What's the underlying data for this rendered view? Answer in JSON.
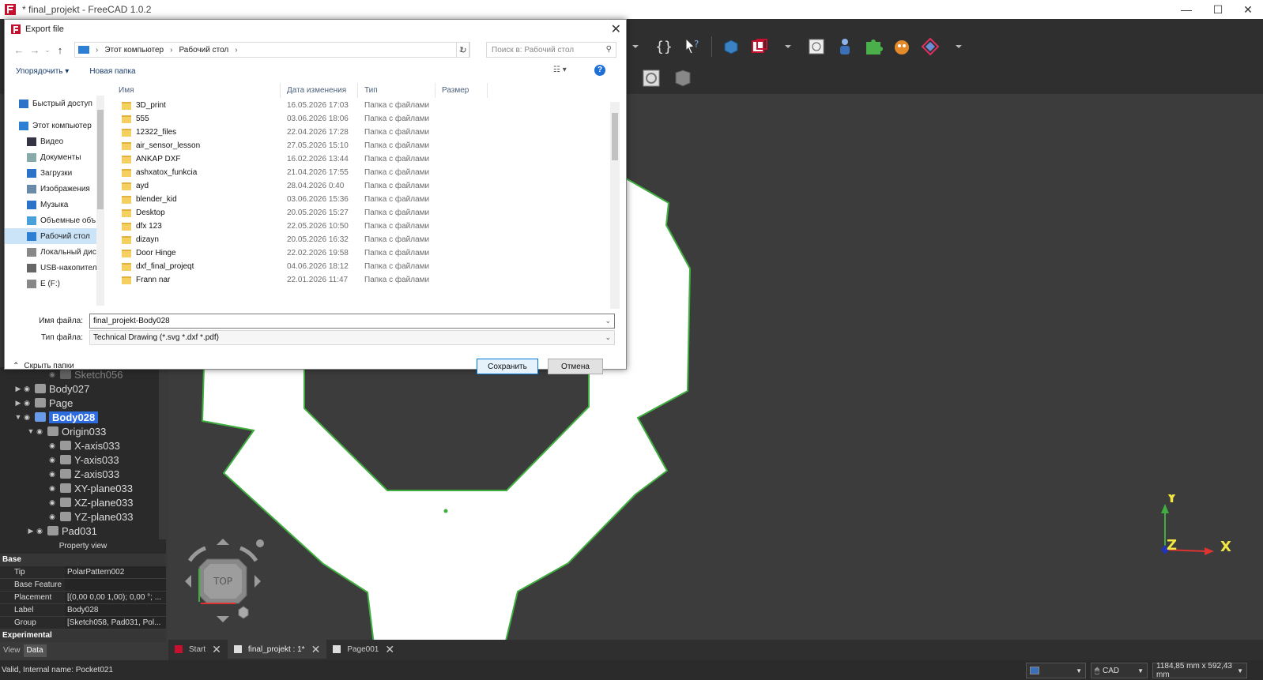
{
  "window": {
    "title": "* final_projekt - FreeCAD 1.0.2",
    "minimize": "—",
    "maximize": "☐",
    "close": "✕"
  },
  "dialog": {
    "title": "Export file",
    "close": "✕",
    "breadcrumb": [
      "Этот компьютер",
      "Рабочий стол"
    ],
    "search_placeholder": "Поиск в: Рабочий стол",
    "organize": "Упорядочить ▾",
    "new_folder": "Новая папка",
    "help": "?",
    "nav_items": [
      {
        "label": "Быстрый доступ",
        "icon": "star-icon",
        "top": true
      },
      {
        "label": "Этот компьютер",
        "icon": "computer-icon",
        "top": true
      },
      {
        "label": "Видео",
        "icon": "video-icon"
      },
      {
        "label": "Документы",
        "icon": "documents-icon"
      },
      {
        "label": "Загрузки",
        "icon": "download-icon"
      },
      {
        "label": "Изображения",
        "icon": "images-icon"
      },
      {
        "label": "Музыка",
        "icon": "music-icon"
      },
      {
        "label": "Объемные объ",
        "icon": "3d-objects-icon"
      },
      {
        "label": "Рабочий стол",
        "icon": "desktop-icon",
        "selected": true
      },
      {
        "label": "Локальный дис",
        "icon": "drive-icon"
      },
      {
        "label": "USB-накопител",
        "icon": "usb-drive-icon"
      },
      {
        "label": "E (F:)",
        "icon": "drive-icon"
      }
    ],
    "columns": [
      "Имя",
      "Дата изменения",
      "Тип",
      "Размер"
    ],
    "files": [
      {
        "name": "3D_print",
        "date": "16.05.2026 17:03",
        "type": "Папка с файлами"
      },
      {
        "name": "555",
        "date": "03.06.2026 18:06",
        "type": "Папка с файлами"
      },
      {
        "name": "12322_files",
        "date": "22.04.2026 17:28",
        "type": "Папка с файлами"
      },
      {
        "name": "air_sensor_lesson",
        "date": "27.05.2026 15:10",
        "type": "Папка с файлами"
      },
      {
        "name": "ANKAP DXF",
        "date": "16.02.2026 13:44",
        "type": "Папка с файлами"
      },
      {
        "name": "ashxatox_funkcia",
        "date": "21.04.2026 17:55",
        "type": "Папка с файлами"
      },
      {
        "name": "ayd",
        "date": "28.04.2026 0:40",
        "type": "Папка с файлами"
      },
      {
        "name": "blender_kid",
        "date": "03.06.2026 15:36",
        "type": "Папка с файлами"
      },
      {
        "name": "Desktop",
        "date": "20.05.2026 15:27",
        "type": "Папка с файлами"
      },
      {
        "name": "dfx 123",
        "date": "22.05.2026 10:50",
        "type": "Папка с файлами"
      },
      {
        "name": "dizayn",
        "date": "20.05.2026 16:32",
        "type": "Папка с файлами"
      },
      {
        "name": "Door Hinge",
        "date": "22.02.2026 19:58",
        "type": "Папка с файлами"
      },
      {
        "name": "dxf_final_projeqt",
        "date": "04.06.2026 18:12",
        "type": "Папка с файлами"
      },
      {
        "name": "Frann nar",
        "date": "22.01.2026 11:47",
        "type": "Папка с файлами"
      }
    ],
    "filename_label": "Имя файла:",
    "filename_value": "final_projekt-Body028",
    "filetype_label": "Тип файла:",
    "filetype_value": "Technical Drawing (*.svg *.dxf *.pdf)",
    "hide_folders": "Скрыть папки",
    "save": "Сохранить",
    "cancel": "Отмена"
  },
  "tree": [
    {
      "label": "Sketch056",
      "indent": 3,
      "arrow": "",
      "eye": true
    },
    {
      "label": "Body027",
      "indent": 1,
      "arrow": "▶",
      "eye": true
    },
    {
      "label": "Page",
      "indent": 1,
      "arrow": "▶",
      "eye": true
    },
    {
      "label": "Body028",
      "indent": 1,
      "arrow": "▼",
      "eye": true,
      "selected": true
    },
    {
      "label": "Origin033",
      "indent": 2,
      "arrow": "▼",
      "eye": true
    },
    {
      "label": "X-axis033",
      "indent": 3,
      "arrow": "",
      "eye": true
    },
    {
      "label": "Y-axis033",
      "indent": 3,
      "arrow": "",
      "eye": true
    },
    {
      "label": "Z-axis033",
      "indent": 3,
      "arrow": "",
      "eye": true
    },
    {
      "label": "XY-plane033",
      "indent": 3,
      "arrow": "",
      "eye": true
    },
    {
      "label": "XZ-plane033",
      "indent": 3,
      "arrow": "",
      "eye": true
    },
    {
      "label": "YZ-plane033",
      "indent": 3,
      "arrow": "",
      "eye": true
    },
    {
      "label": "Pad031",
      "indent": 2,
      "arrow": "▶",
      "eye": true
    }
  ],
  "property_view": {
    "title": "Property view",
    "group_base": "Base",
    "rows": [
      {
        "key": "Tip",
        "value": "PolarPattern002"
      },
      {
        "key": "Base Feature",
        "value": ""
      },
      {
        "key": "Placement",
        "value": "[(0,00 0,00 1,00); 0,00 °; ..."
      },
      {
        "key": "Label",
        "value": "Body028"
      },
      {
        "key": "Group",
        "value": "[Sketch058, Pad031, Pol..."
      }
    ],
    "group_experimental": "Experimental",
    "tab_view": "View",
    "tab_data": "Data"
  },
  "doc_tabs": [
    {
      "label": "Start"
    },
    {
      "label": "final_projekt : 1*",
      "active": true
    },
    {
      "label": "Page001"
    }
  ],
  "navcube": {
    "face": "TOP"
  },
  "axes": {
    "x": "X",
    "y": "Y",
    "z": "Z"
  },
  "status": {
    "text": "Valid, Internal name: Pocket021",
    "nav_style": "CAD",
    "dimensions": "1184,85 mm x 592,43 mm"
  }
}
